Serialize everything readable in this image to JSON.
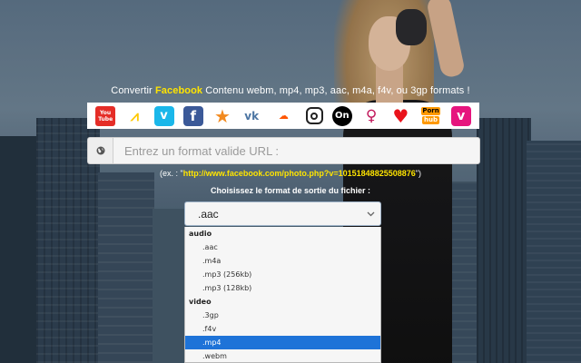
{
  "headline": {
    "prefix": "Convertir ",
    "brand": "Facebook",
    "suffix": " Contenu webm, mp4, mp3, aac, m4a, f4v, ou 3gp formats !"
  },
  "sites": [
    {
      "icon": "youtube-icon",
      "glyph_top": "You",
      "glyph_bottom": "Tube"
    },
    {
      "icon": "dailymotion-icon",
      "glyph": "⩘"
    },
    {
      "icon": "vimeo-icon",
      "glyph": "v"
    },
    {
      "icon": "facebook-icon",
      "glyph": "f"
    },
    {
      "icon": "liveleak-icon",
      "glyph": "★"
    },
    {
      "icon": "vk-icon",
      "glyph": "vk"
    },
    {
      "icon": "soundcloud-icon",
      "glyph": "☁"
    },
    {
      "icon": "instagram-icon",
      "glyph": ""
    },
    {
      "icon": "on-icon",
      "glyph": "On"
    },
    {
      "icon": "lady-icon",
      "glyph": "♀"
    },
    {
      "icon": "heart-icon",
      "glyph": "♥"
    },
    {
      "icon": "pornhub-icon",
      "glyph_top": "Porn",
      "glyph_bottom": "hub"
    },
    {
      "icon": "v-icon",
      "glyph": "v"
    }
  ],
  "url": {
    "icon": "globe-icon",
    "placeholder": "Entrez un format valide URL :"
  },
  "example": {
    "prefix": "(ex. : \"",
    "link": "http://www.facebook.com/photo.php?v=10151848825508876",
    "suffix": "\")"
  },
  "choose_label": "Choisissez le format de sortie du fichier :",
  "format_select": {
    "selected": ".aac",
    "chevron_icon": "chevron-down-icon"
  },
  "dropdown": {
    "groups": [
      {
        "label": "audio",
        "options": [
          ".aac",
          ".m4a",
          ".mp3 (256kb)",
          ".mp3 (128kb)"
        ]
      },
      {
        "label": "video",
        "options": [
          ".3gp",
          ".f4v",
          ".mp4",
          ".webm"
        ]
      }
    ],
    "highlighted": ".mp4"
  },
  "colors": {
    "accent_yellow": "#ffe400",
    "highlight_blue": "#1e73d8"
  }
}
